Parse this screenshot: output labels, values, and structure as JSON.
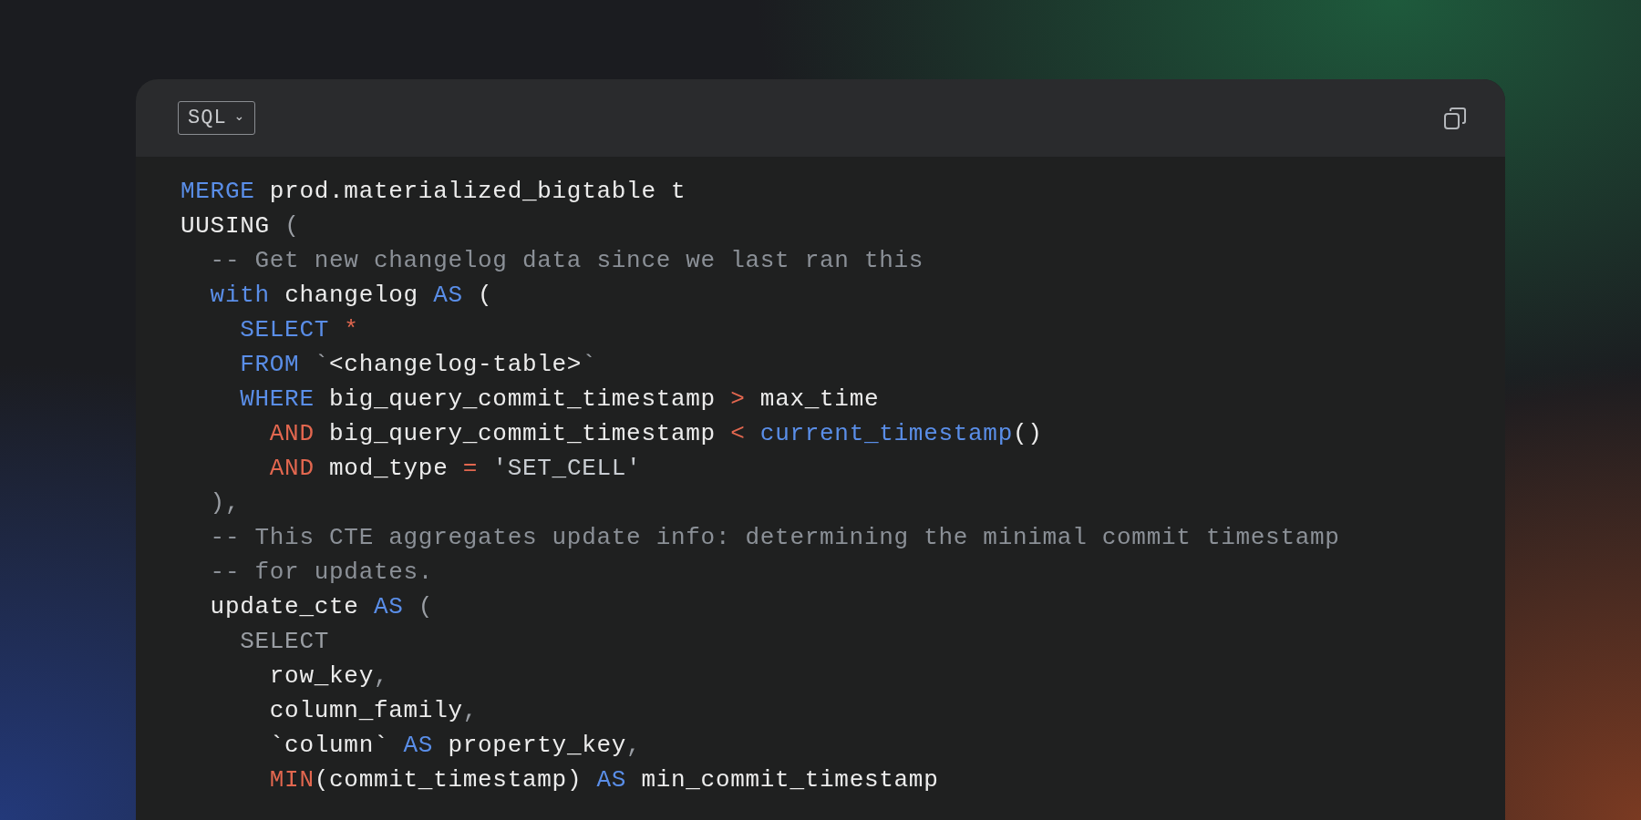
{
  "language_selector": {
    "label": "SQL",
    "caret": "⌄"
  },
  "code_lines": [
    [
      {
        "text": "MERGE",
        "kind": "keyword"
      },
      {
        "text": " prod.materialized_bigtable t",
        "kind": "plain"
      }
    ],
    [
      {
        "text": "UUSING",
        "kind": "plain"
      },
      {
        "text": " (",
        "kind": "punct"
      }
    ],
    [
      {
        "text": "  -- Get new changelog data since we last ran this",
        "kind": "comment"
      }
    ],
    [
      {
        "text": "  with",
        "kind": "keyword"
      },
      {
        "text": " changelog ",
        "kind": "plain"
      },
      {
        "text": "AS",
        "kind": "keyword"
      },
      {
        "text": " (",
        "kind": "plain"
      }
    ],
    [
      {
        "text": "    SELECT",
        "kind": "keyword"
      },
      {
        "text": " *",
        "kind": "operator"
      }
    ],
    [
      {
        "text": "    FROM",
        "kind": "keyword"
      },
      {
        "text": " `",
        "kind": "punct"
      },
      {
        "text": "<changelog-table>",
        "kind": "plain"
      },
      {
        "text": "`",
        "kind": "punct"
      }
    ],
    [
      {
        "text": "    WHERE",
        "kind": "keyword"
      },
      {
        "text": " big_query_commit_timestamp ",
        "kind": "plain"
      },
      {
        "text": ">",
        "kind": "operator"
      },
      {
        "text": " max_time",
        "kind": "plain"
      }
    ],
    [
      {
        "text": "      AND",
        "kind": "operator"
      },
      {
        "text": " big_query_commit_timestamp ",
        "kind": "plain"
      },
      {
        "text": "<",
        "kind": "operator"
      },
      {
        "text": " current_timestamp",
        "kind": "keyword"
      },
      {
        "text": "()",
        "kind": "plain"
      }
    ],
    [
      {
        "text": "      AND",
        "kind": "operator"
      },
      {
        "text": " mod_type ",
        "kind": "plain"
      },
      {
        "text": "=",
        "kind": "operator"
      },
      {
        "text": " 'SET_CELL'",
        "kind": "string"
      }
    ],
    [
      {
        "text": "  ),",
        "kind": "punct"
      }
    ],
    [
      {
        "text": "  -- This CTE aggregates update info: determining the minimal commit timestamp",
        "kind": "comment"
      }
    ],
    [
      {
        "text": "  -- for updates.",
        "kind": "comment"
      }
    ],
    [
      {
        "text": "  update_cte ",
        "kind": "plain"
      },
      {
        "text": "AS",
        "kind": "keyword"
      },
      {
        "text": " (",
        "kind": "punct"
      }
    ],
    [
      {
        "text": "    SELECT",
        "kind": "punct"
      }
    ],
    [
      {
        "text": "      row_key",
        "kind": "plain"
      },
      {
        "text": ",",
        "kind": "punct"
      }
    ],
    [
      {
        "text": "      column_family",
        "kind": "plain"
      },
      {
        "text": ",",
        "kind": "punct"
      }
    ],
    [
      {
        "text": "      `column` ",
        "kind": "plain"
      },
      {
        "text": "AS",
        "kind": "keyword"
      },
      {
        "text": " property_key",
        "kind": "plain"
      },
      {
        "text": ",",
        "kind": "punct"
      }
    ],
    [
      {
        "text": "      MIN",
        "kind": "operator"
      },
      {
        "text": "(commit_timestamp) ",
        "kind": "plain"
      },
      {
        "text": "AS",
        "kind": "keyword"
      },
      {
        "text": " min_commit_timestamp",
        "kind": "plain"
      }
    ]
  ]
}
